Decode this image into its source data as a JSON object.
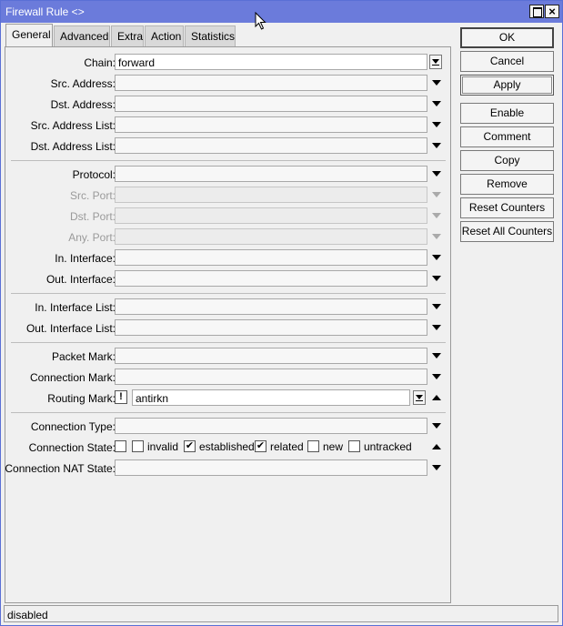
{
  "window": {
    "title": "Firewall Rule <>"
  },
  "tabs": [
    {
      "label": "General",
      "active": true
    },
    {
      "label": "Advanced"
    },
    {
      "label": "Extra"
    },
    {
      "label": "Action"
    },
    {
      "label": "Statistics"
    }
  ],
  "fields": {
    "chain": {
      "label": "Chain:",
      "value": "forward"
    },
    "src_address": {
      "label": "Src. Address:",
      "value": ""
    },
    "dst_address": {
      "label": "Dst. Address:",
      "value": ""
    },
    "src_address_list": {
      "label": "Src. Address List:",
      "value": ""
    },
    "dst_address_list": {
      "label": "Dst. Address List:",
      "value": ""
    },
    "protocol": {
      "label": "Protocol:",
      "value": ""
    },
    "src_port": {
      "label": "Src. Port:",
      "value": ""
    },
    "dst_port": {
      "label": "Dst. Port:",
      "value": ""
    },
    "any_port": {
      "label": "Any. Port:",
      "value": ""
    },
    "in_interface": {
      "label": "In. Interface:",
      "value": ""
    },
    "out_interface": {
      "label": "Out. Interface:",
      "value": ""
    },
    "in_interface_list": {
      "label": "In. Interface List:",
      "value": ""
    },
    "out_interface_list": {
      "label": "Out. Interface List:",
      "value": ""
    },
    "packet_mark": {
      "label": "Packet Mark:",
      "value": ""
    },
    "connection_mark": {
      "label": "Connection Mark:",
      "value": ""
    },
    "routing_mark": {
      "label": "Routing Mark:",
      "value": "antirkn",
      "negate": "!"
    },
    "connection_type": {
      "label": "Connection Type:",
      "value": ""
    },
    "connection_state": {
      "label": "Connection State:",
      "options": [
        {
          "label": "invalid",
          "checked": false
        },
        {
          "label": "established",
          "checked": true
        },
        {
          "label": "related",
          "checked": true
        },
        {
          "label": "new",
          "checked": false
        },
        {
          "label": "untracked",
          "checked": false
        }
      ]
    },
    "connection_nat_state": {
      "label": "Connection NAT State:",
      "value": ""
    }
  },
  "buttons": {
    "ok": "OK",
    "cancel": "Cancel",
    "apply": "Apply",
    "enable": "Enable",
    "comment": "Comment",
    "copy": "Copy",
    "remove": "Remove",
    "reset_counters": "Reset Counters",
    "reset_all_counters": "Reset All Counters"
  },
  "status": {
    "text": "disabled"
  },
  "check_glyph": "✔"
}
